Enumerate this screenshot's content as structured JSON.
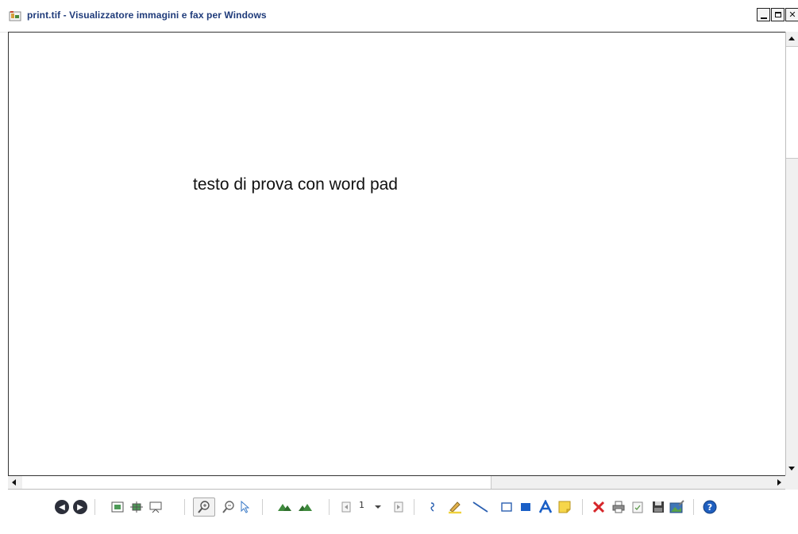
{
  "window": {
    "title": "print.tif - Visualizzatore immagini e fax per Windows"
  },
  "document": {
    "text": "testo di prova con word pad"
  },
  "toolbar": {
    "page_number": "1"
  },
  "colors": {
    "title_text": "#1f3b7a",
    "nav_button": "#2c2f3a",
    "delete_red": "#d6262a",
    "help_blue": "#1f5fbf",
    "rect_fill_blue": "#1a5fc6",
    "sticky_yellow": "#f6d64a"
  },
  "icons": [
    "back-icon",
    "forward-icon",
    "best-fit-icon",
    "actual-size-icon",
    "slideshow-icon",
    "zoom-in-icon",
    "zoom-out-icon",
    "select-pointer-icon",
    "rotate-cw-icon",
    "rotate-ccw-icon",
    "prev-page-icon",
    "page-dropdown-icon",
    "next-page-icon",
    "freehand-icon",
    "highlighter-icon",
    "line-icon",
    "hollow-rectangle-icon",
    "filled-rectangle-icon",
    "text-icon",
    "note-icon",
    "delete-icon",
    "print-icon",
    "copy-icon",
    "save-icon",
    "edit-image-icon",
    "help-icon"
  ]
}
